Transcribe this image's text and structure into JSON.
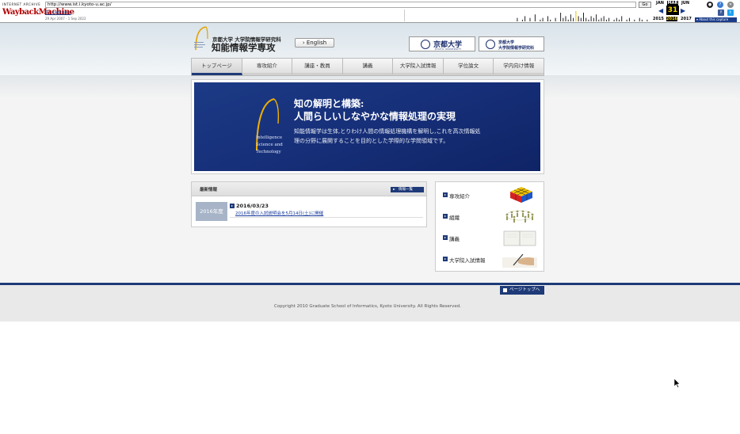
{
  "wayback": {
    "logo_top": "INTERNET ARCHIVE",
    "logo_main": "WaybackMachine",
    "url": "http://www.ist.i.kyoto-u.ac.jp/",
    "go": "Go",
    "captures": "71 captures",
    "range": "29 Apr 2007 - 1 Sep 2022",
    "months": {
      "prev": "JAN",
      "current": "MAR",
      "next": "JUN"
    },
    "day": "31",
    "years": {
      "prev": "2015",
      "current": "2016",
      "next": "2017"
    },
    "about": "About this capture",
    "sparkline": [
      0,
      0,
      0,
      0,
      0,
      0,
      0,
      0,
      0,
      0,
      0,
      0,
      0,
      0,
      0,
      0,
      0,
      0,
      0,
      0,
      0,
      0,
      0,
      0,
      0,
      0,
      0,
      0,
      0,
      0,
      0,
      0,
      0,
      0,
      0,
      0,
      0,
      0,
      0,
      0,
      0,
      0,
      0,
      0,
      2,
      0,
      1,
      3,
      0,
      2,
      0,
      4,
      0,
      1,
      2,
      0,
      3,
      1,
      0,
      2,
      0,
      5,
      2,
      3,
      1,
      4,
      2,
      6,
      3,
      2,
      5,
      2,
      1,
      3,
      2,
      4,
      1,
      2,
      3,
      1,
      2,
      0,
      1,
      2,
      1,
      3,
      0,
      1,
      2,
      0,
      1,
      0,
      2,
      1,
      0,
      1,
      0,
      0
    ]
  },
  "header": {
    "university_line": "京都大学 大学院情報学研究科",
    "department": "知能情報学専攻",
    "english_button": "English",
    "kyoto_logo_jp": "京都大学",
    "kyoto_logo_en": "KYOTO UNIVERSITY",
    "informatics_logo_line1": "京都大学",
    "informatics_logo_line2": "大学院情報学研究科"
  },
  "nav": {
    "items": [
      {
        "label": "トップページ",
        "active": true
      },
      {
        "label": "専攻紹介"
      },
      {
        "label": "講座・教員"
      },
      {
        "label": "講義"
      },
      {
        "label": "大学院入試情報"
      },
      {
        "label": "学位論文"
      },
      {
        "label": "学内向け情報"
      }
    ]
  },
  "hero": {
    "logo_text": "Intelligence Science and Technology",
    "title_line1": "知の解明と構築:",
    "title_line2": "人間らしいしなやかな情報処理の実現",
    "description": "知能情報学は生体,とりわけ人間の情報処理機構を解明し,これを高次情報処理の分野に展開することを目的とした学際的な学問領域です。"
  },
  "news": {
    "title": "最新情報",
    "view_all": "情報一覧",
    "year": "2016年度",
    "date": "2016/03/23",
    "link": "2016年度の入試説明会を5月14日(土)に開催"
  },
  "side_menu": {
    "items": [
      {
        "label": "専攻紹介",
        "icon": "rubiks-cube-icon"
      },
      {
        "label": "組織",
        "icon": "people-circle-icon"
      },
      {
        "label": "講義",
        "icon": "notebook-icon"
      },
      {
        "label": "大学院入試情報",
        "icon": "hand-writing-icon"
      }
    ]
  },
  "footer": {
    "page_top": "ページトップへ",
    "copyright": "Copyright 2010 Graduate School of Informatics, Kyoto University. All Rights Reserved."
  },
  "colors": {
    "navy": "#1f3a78",
    "hero_blue": "#17307a",
    "wayback_red": "#b00000",
    "link_blue": "#1a3c9e"
  }
}
